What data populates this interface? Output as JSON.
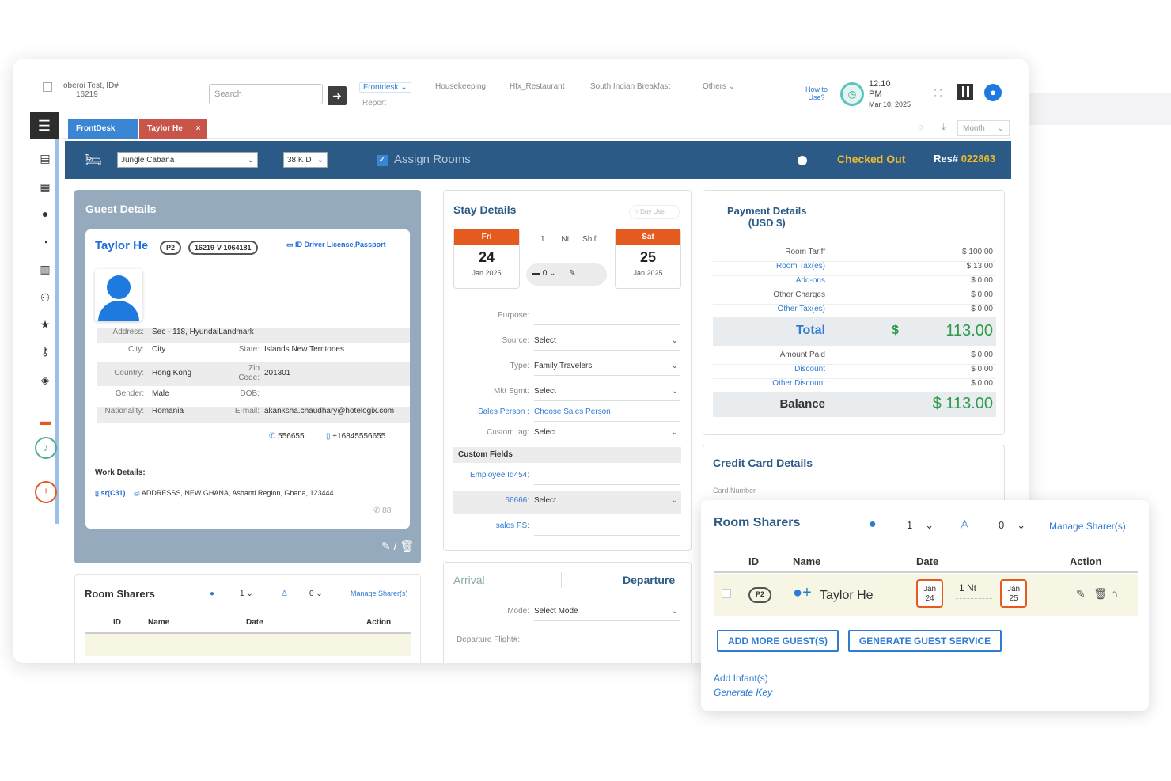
{
  "topbar": {
    "hotel_name": "oberoi Test, ID#",
    "hotel_id": "16219",
    "search_placeholder": "Search",
    "nav": [
      "Frontdesk",
      "Housekeeping",
      "Hfx_Restaurant",
      "South Indian Breakfast",
      "Others"
    ],
    "nav_sub": "Report",
    "howto": "How to Use?",
    "time": "12:10",
    "ampm": "PM",
    "date": "Mar 10, 2025"
  },
  "sidebar": {
    "icons": [
      "menu-icon",
      "clipboard-icon",
      "grid-icon",
      "user-icon",
      "pie-chart-icon",
      "bar-chart-icon",
      "users-icon",
      "star-icon",
      "key-icon",
      "layers-icon"
    ]
  },
  "tabs": {
    "items": [
      "FrontDesk",
      "Taylor He"
    ],
    "close": "×",
    "month": "Month"
  },
  "roombar": {
    "room_type": "Jungle Cabana",
    "room_no": "38 K D",
    "assign_label": "Assign Rooms",
    "status": "Checked Out",
    "res_label": "Res#",
    "res_no": "022863"
  },
  "guest": {
    "section_title": "Guest Details",
    "name": "Taylor He",
    "pax": "P2",
    "guest_id": "16219-V-1064181",
    "id_label": "ID Driver License,Passport",
    "address_label": "Address:",
    "address": "Sec - 118, HyundaiLandmark",
    "city_label": "City:",
    "city": "City",
    "state_label": "State:",
    "state": "Islands New Territories",
    "country_label": "Country:",
    "country": "Hong Kong",
    "zip_label": "Zip Code:",
    "zip": "201301",
    "gender_label": "Gender:",
    "gender": "Male",
    "dob_label": "DOB:",
    "dob": "",
    "nationality_label": "Nationality:",
    "nationality": "Romania",
    "email_label": "E-mail:",
    "email": "akanksha.chaudhary@hotelogix.com",
    "phone": "556655",
    "mobile": "+16845556655",
    "work_label": "Work Details:",
    "work_id": "sr(C31)",
    "work_address": "ADDRESSS, NEW GHANA, Ashanti Region, Ghana, 123444",
    "work_phone": "88"
  },
  "roomsharers_small": {
    "title": "Room Sharers",
    "adults": "1",
    "children": "0",
    "manage": "Manage Sharer(s)",
    "headers": [
      "ID",
      "Name",
      "Date",
      "Action"
    ]
  },
  "stay": {
    "title": "Stay Details",
    "day_use": "Day Use",
    "arrival": {
      "dow": "Fri",
      "day": "24",
      "month": "Jan 2025"
    },
    "departure": {
      "dow": "Sat",
      "day": "25",
      "month": "Jan 2025"
    },
    "nights": "1",
    "nt": "Nt",
    "shift": "Shift",
    "beds": "0",
    "fields": [
      {
        "label": "Purpose:",
        "value": ""
      },
      {
        "label": "Source:",
        "value": "Select"
      },
      {
        "label": "Type:",
        "value": "Family Travelers"
      },
      {
        "label": "Mkt Sgmt:",
        "value": "Select"
      },
      {
        "label": "Sales Person :",
        "value": "Choose Sales Person"
      },
      {
        "label": "Custom tag:",
        "value": "Select"
      }
    ],
    "custom_fields_title": "Custom Fields",
    "custom_fields": [
      {
        "label": "Employee Id454:",
        "value": ""
      },
      {
        "label": "66666:",
        "value": "Select"
      },
      {
        "label": "sales PS:",
        "value": ""
      }
    ]
  },
  "arrival": {
    "arrival_label": "Arrival",
    "departure_label": "Departure",
    "mode_label": "Mode:",
    "mode_value": "Select Mode",
    "flight_label": "Departure Flight#:"
  },
  "payment": {
    "title": "Payment Details",
    "currency": "(USD $)",
    "rows1": [
      {
        "label": "Room Tariff",
        "value": "$ 100.00",
        "blue": false
      },
      {
        "label": "Room Tax(es)",
        "value": "$ 13.00",
        "blue": true
      },
      {
        "label": "Add-ons",
        "value": "$ 0.00",
        "blue": true
      },
      {
        "label": "Other Charges",
        "value": "$ 0.00",
        "blue": false
      },
      {
        "label": "Other Tax(es)",
        "value": "$ 0.00",
        "blue": true
      }
    ],
    "total_label": "Total",
    "total_currency": "$",
    "total_value": "113.00",
    "rows2": [
      {
        "label": "Amount Paid",
        "value": "$ 0.00",
        "blue": false
      },
      {
        "label": "Discount",
        "value": "$ 0.00",
        "blue": true
      },
      {
        "label": "Other Discount",
        "value": "$ 0.00",
        "blue": true
      }
    ],
    "balance_label": "Balance",
    "balance_value": "$ 113.00"
  },
  "credit_card": {
    "title": "Credit Card Details",
    "card_number_label": "Card Number"
  },
  "popup": {
    "title": "Room Sharers",
    "adults": "1",
    "children": "0",
    "manage": "Manage Sharer(s)",
    "headers": [
      "ID",
      "Name",
      "Date",
      "Action"
    ],
    "row": {
      "id": "P2",
      "name": "Taylor He",
      "from_month": "Jan",
      "from_day": "24",
      "nights": "1 Nt",
      "to_month": "Jan",
      "to_day": "25"
    },
    "btn_add": "ADD MORE GUEST(S)",
    "btn_service": "GENERATE GUEST SERVICE",
    "add_infant": "Add Infant(s)",
    "generate_key": "Generate Key"
  },
  "colors": {
    "bar": "#2a5a85",
    "accent": "#2f7bd1",
    "date_header": "#e55a1e",
    "status": "#f1b82d",
    "balance": "#2e9a4a"
  }
}
